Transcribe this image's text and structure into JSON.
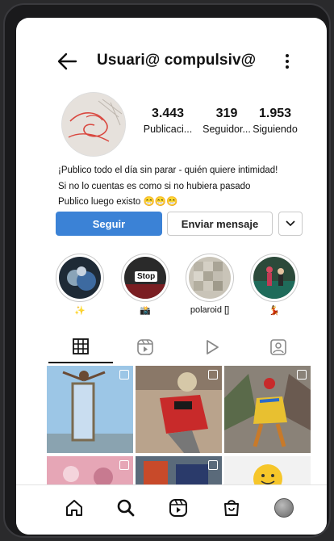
{
  "header": {
    "username": "Usuari@ compulsiv@"
  },
  "stats": {
    "posts": {
      "value": "3.443",
      "label": "Publicaci..."
    },
    "followers": {
      "value": "319",
      "label": "Seguidor..."
    },
    "following": {
      "value": "1.953",
      "label": "Siguiendo"
    }
  },
  "bio": [
    "¡Publico todo el día sin parar - quién quiere intimidad!",
    "Si no lo cuentas es como si no hubiera pasado",
    "Publico luego existo 😁😁😁"
  ],
  "actions": {
    "follow_label": "Seguir",
    "message_label": "Enviar mensaje"
  },
  "highlights": [
    {
      "caption": "✨"
    },
    {
      "caption": "📸",
      "sticker_text": "Stop"
    },
    {
      "caption": "polaroid []"
    },
    {
      "caption": "💃"
    }
  ],
  "tabs": [
    "grid-icon",
    "reels-icon",
    "play-icon",
    "tagged-icon"
  ],
  "bottom_nav": [
    "home-icon",
    "search-icon",
    "reels-icon",
    "shop-icon",
    "profile-avatar"
  ],
  "colors": {
    "follow_button": "#3b82d6"
  }
}
